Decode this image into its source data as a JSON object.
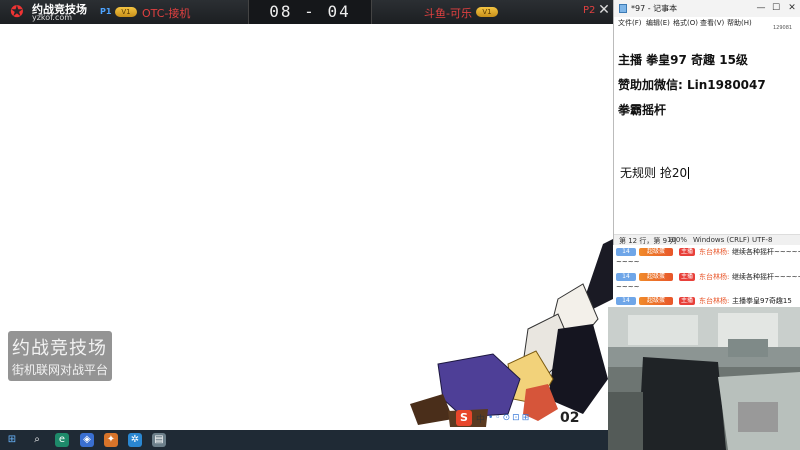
{
  "game_bar": {
    "logo_title": "约战竞技场",
    "logo_url": "yzkof.com",
    "p1_tag": "P1",
    "p1_badge": "V1",
    "p1_name": "OTC-接机",
    "score": "08 - 04",
    "p2_name": "斗鱼-可乐",
    "p2_badge": "V1",
    "p2_suffix": "P2",
    "close_icon": "close-icon"
  },
  "game": {
    "watermark_line1": "约战竞技场",
    "watermark_line2": "街机联网对战平台",
    "hud_lang": "中",
    "hud_dots": "•◦⊙⊡⊞",
    "hud_number": "02"
  },
  "notepad": {
    "title": "*97 - 记事本",
    "minimize": "—",
    "maximize": "☐",
    "close": "✕",
    "menu": [
      "文件(F)",
      "编辑(E)",
      "格式(O)",
      "查看(V)",
      "帮助(H)"
    ],
    "corner_code": "129081",
    "lines": [
      "主播 拳皇97 奇趣 15级",
      "赞助加微信: Lin1980047",
      "拳霸摇杆",
      "无规则 抢20"
    ],
    "status": {
      "position": "第 12 行，第 9 列",
      "zoom": "100%",
      "line_ending": "Windows (CRLF)",
      "encoding": "UTF-8"
    }
  },
  "chat": {
    "messages": [
      {
        "level": "14",
        "fan": "超级蛋",
        "role": "主播",
        "user": "东台林杨:",
        "text": "继续各种摇杆~~~~~~",
        "cont": "~~~~"
      },
      {
        "level": "14",
        "fan": "超级蛋",
        "role": "主播",
        "user": "东台林杨:",
        "text": "继续各种摇杆~~~~~~",
        "cont": "~~~~"
      },
      {
        "level": "14",
        "fan": "超级蛋",
        "role": "主播",
        "user": "东台林杨:",
        "text": "主播拳皇97奇趣15",
        "cont": ""
      }
    ]
  },
  "colors": {
    "accent_red": "#e04040",
    "taskbar": "#1f2a35",
    "chat_user": "#e8562a"
  }
}
